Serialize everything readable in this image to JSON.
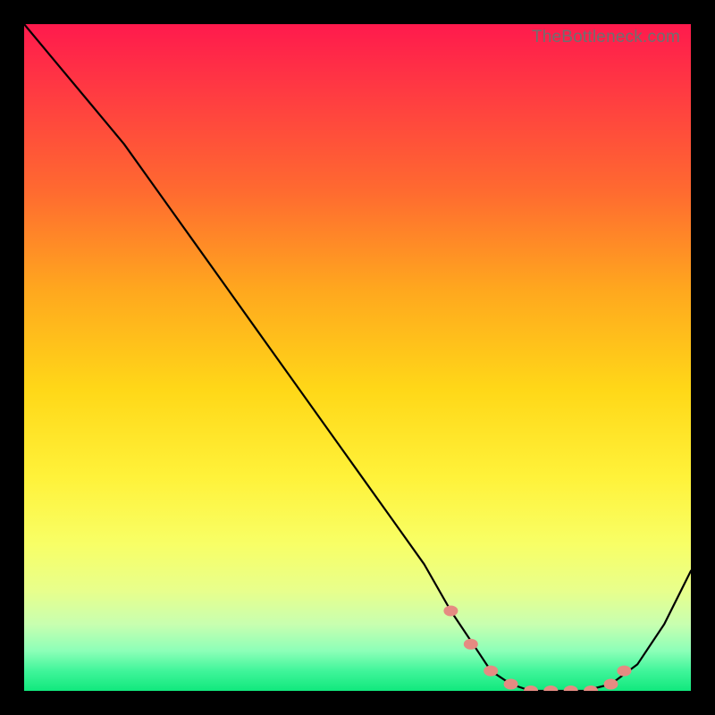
{
  "watermark": "TheBottleneck.com",
  "chart_data": {
    "type": "line",
    "title": "",
    "xlabel": "",
    "ylabel": "",
    "xlim": [
      0,
      100
    ],
    "ylim": [
      0,
      100
    ],
    "background_gradient": {
      "top_color": "#ff1a4d",
      "bottom_color": "#11e87d",
      "meaning": "bottleneck severity (red=high, green=low)"
    },
    "series": [
      {
        "name": "bottleneck-curve",
        "x": [
          0,
          5,
          10,
          15,
          20,
          25,
          30,
          35,
          40,
          45,
          50,
          55,
          60,
          64,
          68,
          70,
          73,
          76,
          80,
          84,
          88,
          92,
          96,
          100
        ],
        "values": [
          100,
          94,
          88,
          82,
          75,
          68,
          61,
          54,
          47,
          40,
          33,
          26,
          19,
          12,
          6,
          3,
          1,
          0,
          0,
          0,
          1,
          4,
          10,
          18
        ]
      }
    ],
    "markers": {
      "name": "highlight-dots",
      "color": "#e58b82",
      "x": [
        64,
        67,
        70,
        73,
        76,
        79,
        82,
        85,
        88,
        90
      ],
      "values": [
        12,
        7,
        3,
        1,
        0,
        0,
        0,
        0,
        1,
        3
      ]
    }
  }
}
